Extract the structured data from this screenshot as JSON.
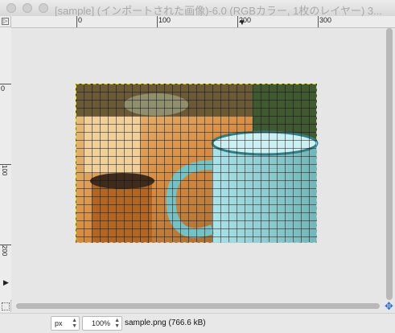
{
  "window": {
    "title": "[sample] (インポートされた画像)-6.0 (RGBカラー, 1枚のレイヤー) 3..."
  },
  "rulers": {
    "corner_glyph": "▷",
    "horizontal_labels": [
      "0",
      "100",
      "200",
      "300"
    ],
    "vertical_labels": [
      "0",
      "100",
      "200"
    ],
    "pointer_marker": "▼",
    "vertical_marker": "▶"
  },
  "canvas": {
    "image_name": "sample.png",
    "selection": "grid overlay with dashed selection boundary"
  },
  "navigation": {
    "icon": "move-arrows-icon",
    "glyph": "✥"
  },
  "status_bar": {
    "unit": "px",
    "zoom": "100%",
    "image_info": "sample.png (766.6 kB)"
  },
  "colors": {
    "titlebar_text": "#a9a9a9",
    "grid_line": "#111111",
    "nav_icon": "#2a6bd6"
  }
}
